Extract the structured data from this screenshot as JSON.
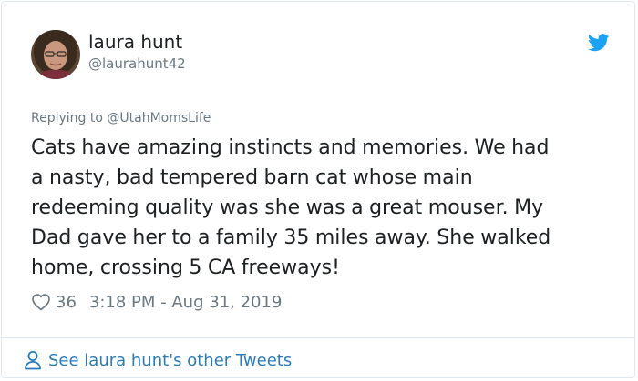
{
  "author": {
    "display_name": "laura hunt",
    "handle": "@laurahunt42",
    "avatar_icon": "user-avatar"
  },
  "reply": {
    "prefix": "Replying to",
    "mention": "@UtahMomsLife"
  },
  "tweet": {
    "lines": [
      "Cats have amazing instincts and memories. We had",
      "a nasty, bad tempered barn cat whose main",
      "redeeming quality was she was a great mouser. My",
      "Dad gave her to a family 35 miles away. She walked",
      "home, crossing 5 CA freeways!"
    ]
  },
  "meta": {
    "like_count": "36",
    "timestamp": "3:18 PM - Aug 31, 2019",
    "heart_icon": "heart-outline-icon"
  },
  "footer": {
    "link_text": "See laura hunt's other Tweets",
    "icon": "person-outline-icon"
  },
  "brand": {
    "icon": "twitter-bird-icon",
    "twitter_blue": "#1da1f2",
    "link_blue": "#2b7bb9",
    "muted_gray": "#697882"
  }
}
